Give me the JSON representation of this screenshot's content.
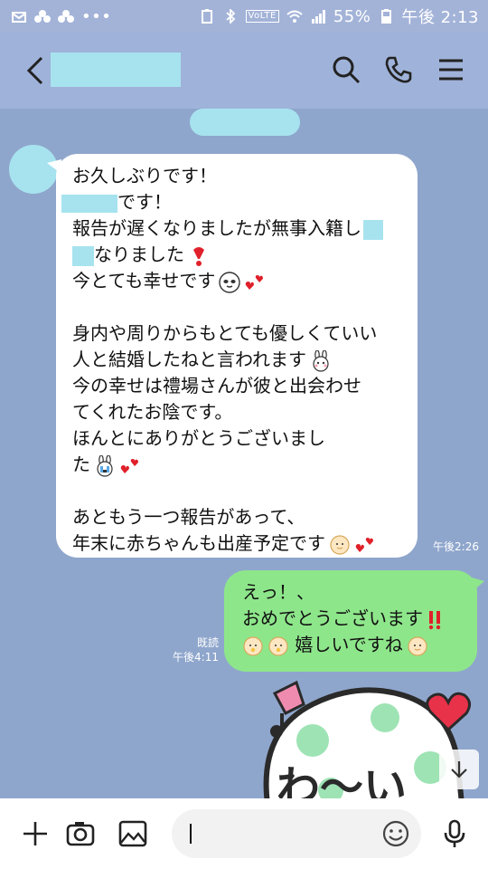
{
  "status_bar": {
    "battery": "55%",
    "time": "午後 2:13",
    "network_label": "VoLTE",
    "dots": "•••"
  },
  "header": {
    "back_icon": "chevron-left-icon",
    "search_icon": "search-icon",
    "call_icon": "phone-icon",
    "menu_icon": "menu-icon"
  },
  "messages": {
    "incoming": {
      "lines": [
        "お久しぶりです！",
        "です！",
        "報告が遅くなりましたが無事入籍し",
        "なりました",
        "今とても幸せです",
        "身内や周りからもとても優しくていい",
        "人と結婚したねと言われます",
        "今の幸せは禮場さんが彼と出会わせ",
        "てくれたお陰です。",
        "ほんとにありがとうございまし",
        "た",
        "あともう一つ報告があって、",
        "年末に赤ちゃんも出産予定です"
      ],
      "time": "午後2:26"
    },
    "outgoing": {
      "lines": [
        "えっ！、",
        "おめでとうございます",
        "嬉しいですね"
      ],
      "read_label": "既読",
      "time": "午後4:11"
    }
  },
  "input": {
    "plus_icon": "plus-icon",
    "camera_icon": "camera-icon",
    "image_icon": "image-icon",
    "emoji_icon": "smiley-icon",
    "mic_icon": "microphone-icon"
  },
  "sticker": {
    "text": "わ〜い"
  },
  "colors": {
    "background": "#8fa6cc",
    "bubble_in": "#ffffff",
    "bubble_out": "#8ee68b",
    "redaction": "#a7e3ef"
  }
}
